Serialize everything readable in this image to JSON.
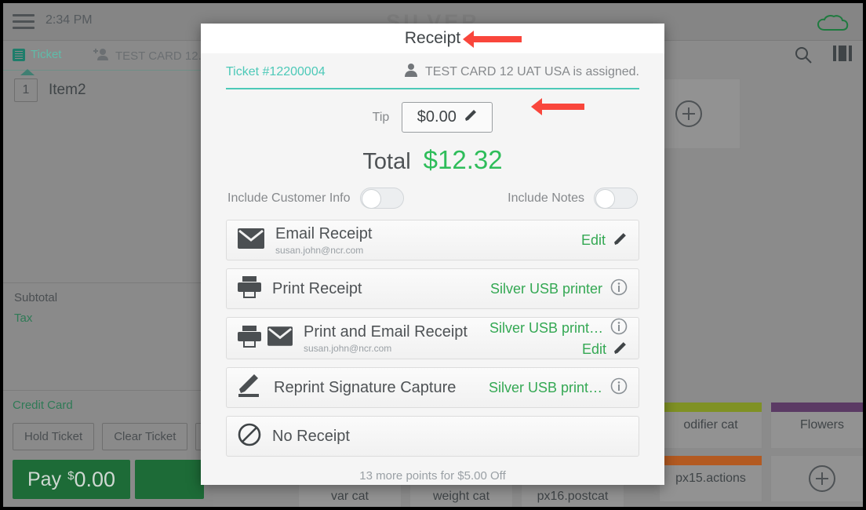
{
  "background": {
    "topbar": {
      "menu_icon": "hamburger-icon",
      "time": "2:34 PM",
      "brand": "SILVER",
      "cloud_icon": "cloud-icon"
    },
    "ticket_panel": {
      "tab_ticket": "Ticket",
      "tab_customer": "TEST CARD 12...",
      "item_qty": "1",
      "item_name": "Item2",
      "subtotal_label": "Subtotal",
      "tax_label": "Tax",
      "tender_label": "Credit Card",
      "hold_button": "Hold Ticket",
      "clear_button": "Clear Ticket",
      "pay_label": "Pay",
      "pay_currency": "$",
      "pay_amount": "0.00"
    },
    "menu_area": {
      "search_icon": "search-icon",
      "layout_icon": "grid-layout-icon",
      "tiles": [
        {
          "label": "odifier cat",
          "strip": "#7f9124"
        },
        {
          "label": "Flowers",
          "strip": "#5b3a64"
        },
        {
          "label": "px15.actions",
          "strip": "#b35a21"
        },
        {
          "label": "",
          "strip": ""
        },
        {
          "label": "var cat",
          "strip": ""
        },
        {
          "label": "weight cat",
          "strip": ""
        },
        {
          "label": "px16.postcat",
          "strip": ""
        }
      ],
      "add_tile_icon": "plus-circle-icon"
    }
  },
  "modal": {
    "title": "Receipt",
    "ticket_number": "Ticket #12200004",
    "assignee_icon": "person-icon",
    "assignee_text": "TEST CARD 12 UAT USA  is assigned.",
    "tip": {
      "label": "Tip",
      "value": "$0.00",
      "edit_icon": "pencil-icon"
    },
    "total": {
      "label": "Total",
      "value": "$12.32"
    },
    "toggles": [
      {
        "label": "Include Customer Info",
        "state": "off"
      },
      {
        "label": "Include Notes",
        "state": "off"
      }
    ],
    "options": [
      {
        "title": "Email Receipt",
        "subtitle": "susan.john@ncr.com",
        "icons": [
          "envelope-icon"
        ],
        "action_label": "Edit",
        "action_icon": "pencil-icon"
      },
      {
        "title": "Print Receipt",
        "subtitle": "",
        "icons": [
          "printer-icon"
        ],
        "device_label": "Silver USB printer",
        "info_icon": "info-icon"
      },
      {
        "title": "Print and Email Receipt",
        "subtitle": "susan.john@ncr.com",
        "icons": [
          "printer-icon",
          "envelope-icon"
        ],
        "device_label": "Silver USB print…",
        "info_icon": "info-icon",
        "action_label": "Edit",
        "action_icon": "pencil-icon"
      },
      {
        "title": "Reprint Signature Capture",
        "subtitle": "",
        "icons": [
          "signature-pencil-icon"
        ],
        "device_label": "Silver USB print…",
        "info_icon": "info-icon"
      },
      {
        "title": "No Receipt",
        "subtitle": "",
        "icons": [
          "no-entry-icon"
        ]
      }
    ],
    "points_note": "13 more points for $5.00 Off"
  },
  "annotations": {
    "arrow_color": "#f9463c",
    "arrow_title_target": "Receipt",
    "arrow_tip_target": "$0.00"
  },
  "colors": {
    "teal": "#4dc9b8",
    "green": "#34a853",
    "total_green": "#2ebd5a",
    "arrow_red": "#f9463c"
  }
}
